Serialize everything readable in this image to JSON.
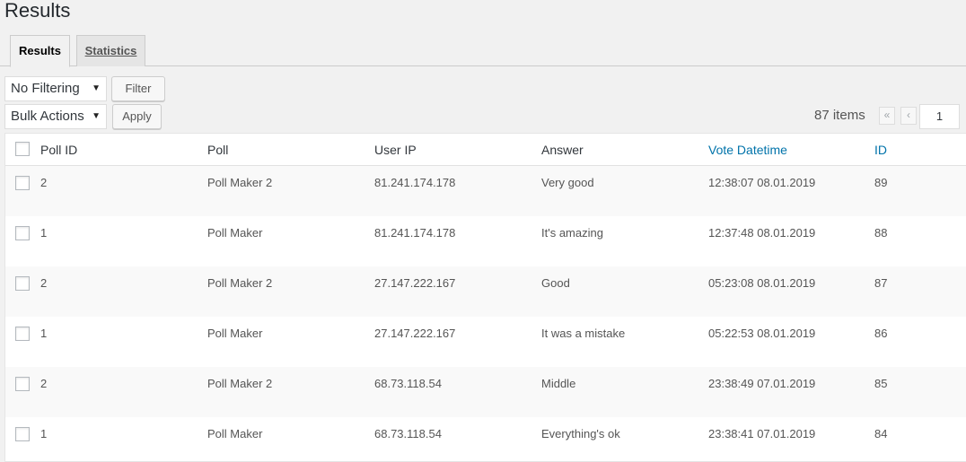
{
  "page": {
    "title": "Results"
  },
  "tabs": [
    {
      "label": "Results",
      "active": true
    },
    {
      "label": "Statistics",
      "active": false
    }
  ],
  "toolbar": {
    "filter_select": "No Filtering",
    "filter_button": "Filter",
    "bulk_select": "Bulk Actions",
    "apply_button": "Apply"
  },
  "pagination": {
    "items_count": "87 items",
    "first": "«",
    "prev": "‹",
    "current_page": "1"
  },
  "table": {
    "columns": {
      "poll_id": "Poll ID",
      "poll": "Poll",
      "user_ip": "User IP",
      "answer": "Answer",
      "vote_datetime": "Vote Datetime",
      "id": "ID"
    },
    "rows": [
      {
        "poll_id": "2",
        "poll": "Poll Maker 2",
        "user_ip": "81.241.174.178",
        "answer": "Very good",
        "vote_datetime": "12:38:07 08.01.2019",
        "id": "89"
      },
      {
        "poll_id": "1",
        "poll": "Poll Maker",
        "user_ip": "81.241.174.178",
        "answer": "It's amazing",
        "vote_datetime": "12:37:48 08.01.2019",
        "id": "88"
      },
      {
        "poll_id": "2",
        "poll": "Poll Maker 2",
        "user_ip": "27.147.222.167",
        "answer": "Good",
        "vote_datetime": "05:23:08 08.01.2019",
        "id": "87"
      },
      {
        "poll_id": "1",
        "poll": "Poll Maker",
        "user_ip": "27.147.222.167",
        "answer": "It was a mistake",
        "vote_datetime": "05:22:53 08.01.2019",
        "id": "86"
      },
      {
        "poll_id": "2",
        "poll": "Poll Maker 2",
        "user_ip": "68.73.118.54",
        "answer": "Middle",
        "vote_datetime": "23:38:49 07.01.2019",
        "id": "85"
      },
      {
        "poll_id": "1",
        "poll": "Poll Maker",
        "user_ip": "68.73.118.54",
        "answer": "Everything's ok",
        "vote_datetime": "23:38:41 07.01.2019",
        "id": "84"
      }
    ]
  },
  "colors": {
    "link": "#0073aa",
    "background": "#f1f1f1",
    "row_alt": "#f9f9f9"
  }
}
